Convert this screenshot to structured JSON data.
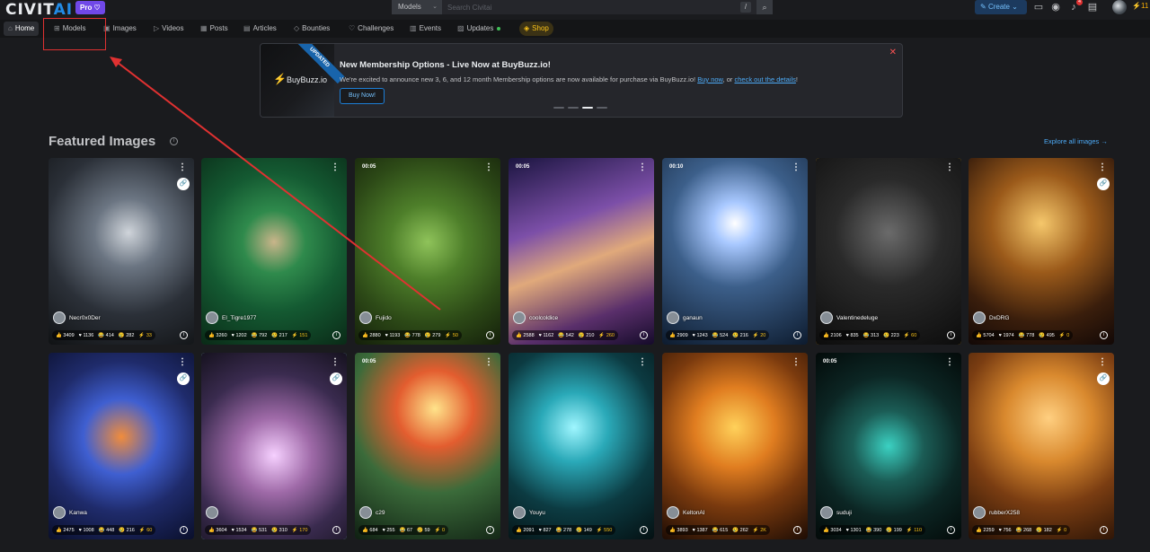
{
  "app": {
    "logo_main": "CIVIT",
    "logo_ai": "AI",
    "pro_label": "Pro ♡"
  },
  "search": {
    "scope": "Models",
    "placeholder": "Search Civitai",
    "shortcut": "/"
  },
  "header": {
    "create_label": "Create",
    "notifications_count": "4",
    "buzz_amount": "11"
  },
  "nav": [
    {
      "label": "Home",
      "icon": "home-icon"
    },
    {
      "label": "Models",
      "icon": "grid-icon"
    },
    {
      "label": "Images",
      "icon": "photo-icon"
    },
    {
      "label": "Videos",
      "icon": "video-icon"
    },
    {
      "label": "Posts",
      "icon": "posts-icon"
    },
    {
      "label": "Articles",
      "icon": "article-icon"
    },
    {
      "label": "Bounties",
      "icon": "bounty-icon"
    },
    {
      "label": "Challenges",
      "icon": "challenge-icon"
    },
    {
      "label": "Events",
      "icon": "calendar-icon"
    },
    {
      "label": "Updates",
      "icon": "updates-icon"
    },
    {
      "label": "Shop",
      "icon": "shop-icon"
    }
  ],
  "banner": {
    "ribbon": "UPDATED",
    "brand": "BuyBuzz.io",
    "title": "New Membership Options - Live Now at BuyBuzz.io!",
    "text": "We're excited to announce new 3, 6, and 12 month Membership options are now available for purchase via BuyBuzz.io!",
    "link1": "Buy now",
    "sep": ", or",
    "link2": "check out the details",
    "end": "!",
    "button": "Buy Now!"
  },
  "featured": {
    "title": "Featured Images",
    "explore": "Explore all images →"
  },
  "cards": [
    {
      "user": "Necr0x0Der",
      "time": "",
      "stats": [
        "3409",
        "1136",
        "414",
        "282",
        "33"
      ]
    },
    {
      "user": "El_Tigre1977",
      "time": "",
      "stats": [
        "3260",
        "1202",
        "792",
        "217",
        "151"
      ]
    },
    {
      "user": "Fujido",
      "time": "00:05",
      "stats": [
        "2880",
        "1193",
        "778",
        "279",
        "50"
      ]
    },
    {
      "user": "coolcoldice",
      "time": "00:05",
      "stats": [
        "2588",
        "1162",
        "542",
        "210",
        "260"
      ]
    },
    {
      "user": "ganaun",
      "time": "00:10",
      "stats": [
        "2909",
        "1243",
        "524",
        "216",
        "20"
      ]
    },
    {
      "user": "Valentinedeluge",
      "time": "",
      "stats": [
        "2106",
        "835",
        "313",
        "223",
        "60"
      ]
    },
    {
      "user": "DxDRG",
      "time": "",
      "stats": [
        "5704",
        "1974",
        "778",
        "495",
        "0"
      ]
    },
    {
      "user": "Kanwa",
      "time": "",
      "stats": [
        "2475",
        "1008",
        "448",
        "216",
        "60"
      ]
    },
    {
      "user": "",
      "time": "",
      "stats": [
        "3604",
        "1534",
        "531",
        "310",
        "170"
      ]
    },
    {
      "user": "c29",
      "time": "00:05",
      "stats": [
        "684",
        "255",
        "67",
        "59",
        "0"
      ]
    },
    {
      "user": "Youyu",
      "time": "",
      "stats": [
        "2091",
        "827",
        "278",
        "149",
        "550"
      ]
    },
    {
      "user": "KeltonAI",
      "time": "",
      "stats": [
        "3893",
        "1387",
        "615",
        "262",
        "2K"
      ]
    },
    {
      "user": "suduji",
      "time": "00:05",
      "stats": [
        "3034",
        "1301",
        "390",
        "199",
        "110"
      ]
    },
    {
      "user": "rubberX258",
      "time": "",
      "stats": [
        "2259",
        "756",
        "268",
        "182",
        "0"
      ]
    }
  ],
  "colors": {
    "accent": "#228be6",
    "buzz": "#fab005",
    "annotation": "#e03131"
  }
}
